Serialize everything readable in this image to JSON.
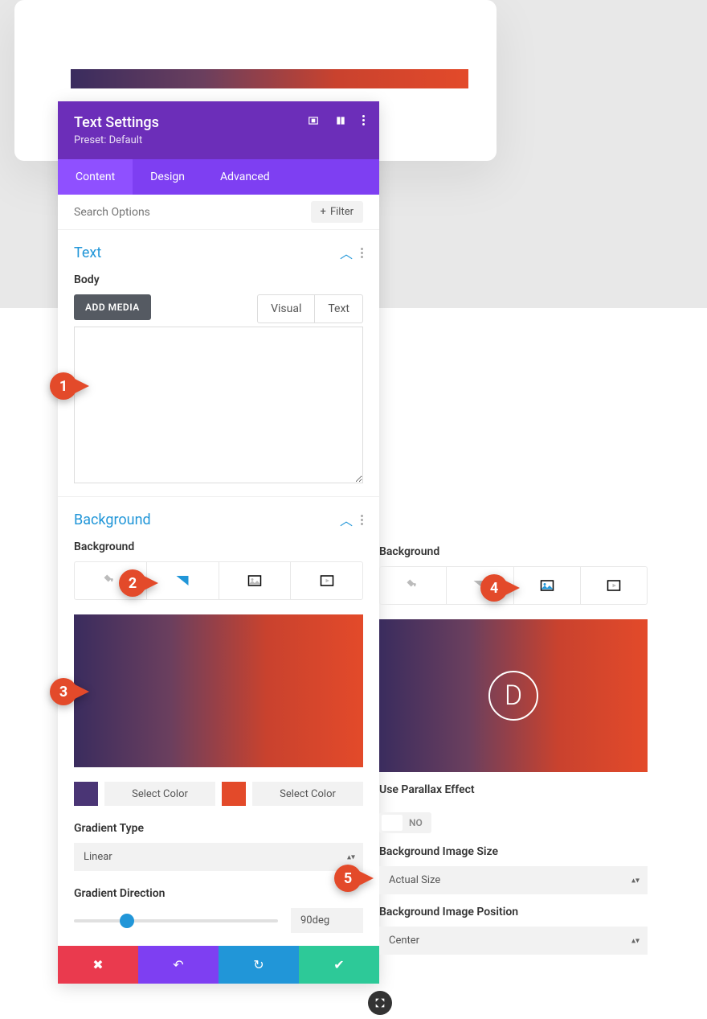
{
  "header": {
    "title": "Text Settings",
    "preset": "Preset: Default"
  },
  "tabs": [
    "Content",
    "Design",
    "Advanced"
  ],
  "search": {
    "placeholder": "Search Options",
    "filter": "Filter"
  },
  "text_section": {
    "title": "Text",
    "body_label": "Body",
    "add_media": "ADD MEDIA",
    "visual": "Visual",
    "text": "Text"
  },
  "bg_section": {
    "title": "Background",
    "label": "Background",
    "select_color": "Select Color",
    "gradient_type_label": "Gradient Type",
    "gradient_type_value": "Linear",
    "gradient_direction_label": "Gradient Direction",
    "gradient_direction_value": "90deg",
    "colors": {
      "start": "#4a3575",
      "end": "#e34a2a"
    }
  },
  "right": {
    "bg_label": "Background",
    "parallax_label": "Use Parallax Effect",
    "parallax_value": "NO",
    "size_label": "Background Image Size",
    "size_value": "Actual Size",
    "position_label": "Background Image Position",
    "position_value": "Center"
  },
  "annotations": [
    "1",
    "2",
    "3",
    "4",
    "5"
  ]
}
